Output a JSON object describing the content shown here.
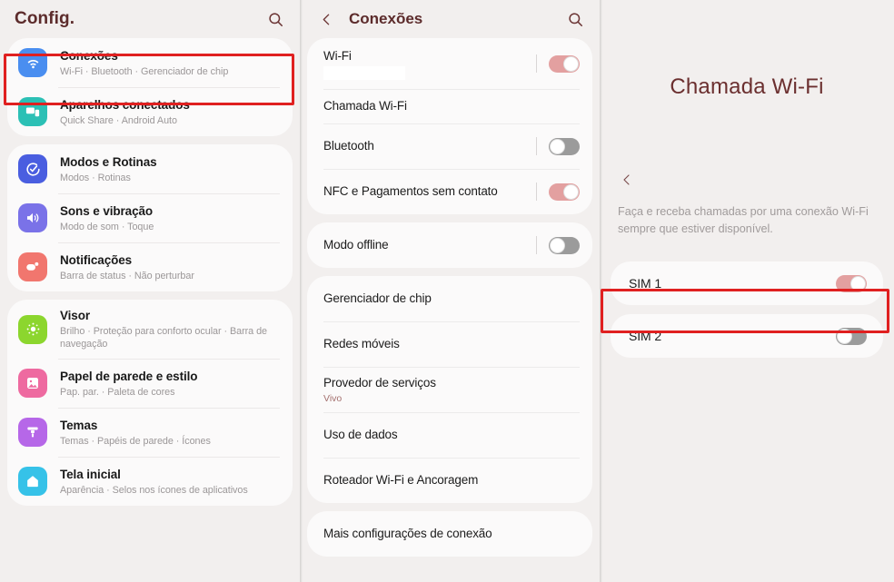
{
  "settings_panel": {
    "title": "Config.",
    "search_icon": "search-icon",
    "groups": [
      {
        "items": [
          {
            "title": "Conexões",
            "subtitle": "Wi-Fi · Bluetooth · Gerenciador de chip",
            "icon": "wifi-icon",
            "icon_color": "#4a8ef0",
            "highlighted": true
          },
          {
            "title": "Aparelhos conectados",
            "subtitle": "Quick Share · Android Auto",
            "icon": "connected-devices-icon",
            "icon_color": "#2cc0b5",
            "highlighted": false
          }
        ]
      },
      {
        "items": [
          {
            "title": "Modos e Rotinas",
            "subtitle": "Modos · Rotinas",
            "icon": "modes-routines-icon",
            "icon_color": "#4a5ee0",
            "highlighted": false
          },
          {
            "title": "Sons e vibração",
            "subtitle": "Modo de som · Toque",
            "icon": "sound-vibration-icon",
            "icon_color": "#7a72e8",
            "highlighted": false
          },
          {
            "title": "Notificações",
            "subtitle": "Barra de status · Não perturbar",
            "icon": "notifications-icon",
            "icon_color": "#f1766e",
            "highlighted": false
          }
        ]
      },
      {
        "items": [
          {
            "title": "Visor",
            "subtitle": "Brilho · Proteção para conforto ocular · Barra de navegação",
            "icon": "display-brightness-icon",
            "icon_color": "#8cd62e",
            "highlighted": false
          },
          {
            "title": "Papel de parede e estilo",
            "subtitle": "Pap. par. · Paleta de cores",
            "icon": "wallpaper-icon",
            "icon_color": "#ee6aa0",
            "highlighted": false
          },
          {
            "title": "Temas",
            "subtitle": "Temas · Papéis de parede · Ícones",
            "icon": "themes-brush-icon",
            "icon_color": "#b667e8",
            "highlighted": false
          },
          {
            "title": "Tela inicial",
            "subtitle": "Aparência · Selos nos ícones de aplicativos",
            "icon": "home-screen-icon",
            "icon_color": "#36c2e8",
            "highlighted": false
          }
        ]
      }
    ]
  },
  "connections_panel": {
    "back_icon": "chevron-left-icon",
    "title": "Conexões",
    "search_icon": "search-icon",
    "groups": [
      {
        "items": [
          {
            "label": "Wi-Fi",
            "sublabel_redacted": true,
            "toggle": "on"
          },
          {
            "label": "Chamada Wi-Fi",
            "toggle": null,
            "highlighted": true
          },
          {
            "label": "Bluetooth",
            "toggle": "off"
          },
          {
            "label": "NFC e Pagamentos sem contato",
            "toggle": "on"
          }
        ]
      },
      {
        "items": [
          {
            "label": "Modo offline",
            "toggle": "off"
          }
        ]
      },
      {
        "items": [
          {
            "label": "Gerenciador de chip",
            "toggle": null
          },
          {
            "label": "Redes móveis",
            "toggle": null
          },
          {
            "label": "Provedor de serviços",
            "sublabel": "Vivo",
            "toggle": null
          },
          {
            "label": "Uso de dados",
            "toggle": null
          },
          {
            "label": "Roteador Wi-Fi e Ancoragem",
            "toggle": null
          }
        ]
      },
      {
        "items": [
          {
            "label": "Mais configurações de conexão",
            "toggle": null
          }
        ]
      }
    ]
  },
  "wifi_calling_panel": {
    "title": "Chamada Wi-Fi",
    "back_icon": "chevron-left-icon",
    "description": "Faça e receba chamadas por uma conexão Wi-Fi sempre que estiver disponível.",
    "sims": [
      {
        "label": "SIM 1",
        "toggle": "on",
        "highlighted": true
      },
      {
        "label": "SIM 2",
        "toggle": "off",
        "highlighted": false
      }
    ]
  },
  "theme": {
    "background": "#f2efee",
    "card": "#fbfafa",
    "accent_title": "#5c2b2b",
    "toggle_on": "#e3a0a0",
    "toggle_off": "#9b9b9b",
    "highlight_border": "#e02020"
  }
}
